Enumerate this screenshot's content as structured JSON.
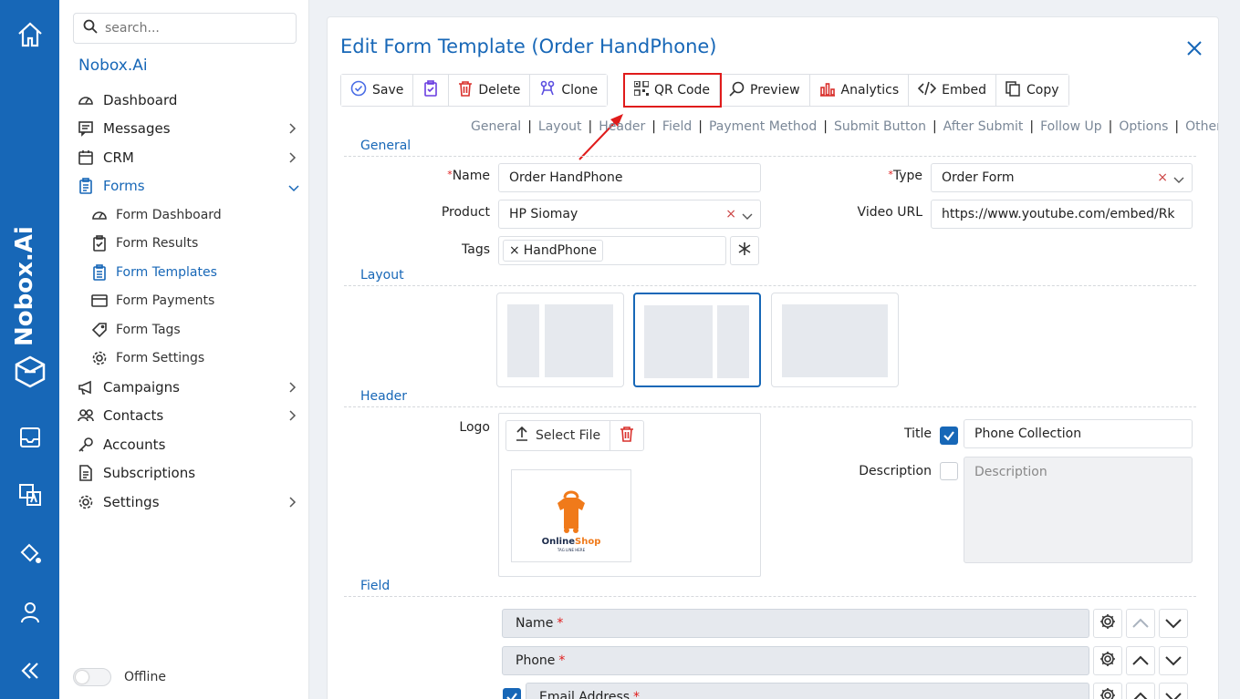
{
  "rail": {
    "brand": "Nobox.Ai",
    "icons": [
      "home-icon",
      "nobox-logo-icon",
      "inbox-icon",
      "translate-icon",
      "paint-bucket-icon",
      "user-icon",
      "collapse-icon"
    ]
  },
  "sidebar": {
    "search_placeholder": "search...",
    "org": "Nobox.Ai",
    "items": [
      {
        "label": "Dashboard",
        "icon": "gauge-icon"
      },
      {
        "label": "Messages",
        "icon": "message-icon"
      },
      {
        "label": "CRM",
        "icon": "crm-icon"
      },
      {
        "label": "Forms",
        "icon": "clipboard-icon"
      },
      {
        "label": "Form Dashboard",
        "icon": "gauge-icon"
      },
      {
        "label": "Form Results",
        "icon": "clipboard-check-icon"
      },
      {
        "label": "Form Templates",
        "icon": "clipboard-list-icon"
      },
      {
        "label": "Form Payments",
        "icon": "credit-card-icon"
      },
      {
        "label": "Form Tags",
        "icon": "tag-icon"
      },
      {
        "label": "Form Settings",
        "icon": "gear-icon"
      },
      {
        "label": "Campaigns",
        "icon": "megaphone-icon"
      },
      {
        "label": "Contacts",
        "icon": "contacts-icon"
      },
      {
        "label": "Accounts",
        "icon": "key-icon"
      },
      {
        "label": "Subscriptions",
        "icon": "document-icon"
      },
      {
        "label": "Settings",
        "icon": "gear-icon"
      }
    ],
    "offline_label": "Offline"
  },
  "page": {
    "title": "Edit Form Template (Order HandPhone)",
    "toolbar": {
      "save": "Save",
      "delete": "Delete",
      "clone": "Clone",
      "qr": "QR Code",
      "preview": "Preview",
      "analytics": "Analytics",
      "embed": "Embed",
      "copy": "Copy"
    },
    "tabs": [
      "General",
      "Layout",
      "Header",
      "Field",
      "Payment Method",
      "Submit Button",
      "After Submit",
      "Follow Up",
      "Options",
      "Other"
    ],
    "sections": {
      "general": "General",
      "layout": "Layout",
      "header": "Header",
      "field": "Field"
    },
    "general": {
      "name_label": "Name",
      "name_value": "Order HandPhone",
      "type_label": "Type",
      "type_value": "Order Form",
      "product_label": "Product",
      "product_value": "HP Siomay",
      "video_label": "Video URL",
      "video_value": "https://www.youtube.com/embed/Rk",
      "tags_label": "Tags",
      "tag_chip": "HandPhone"
    },
    "layout": {
      "selected": 1
    },
    "header": {
      "logo_label": "Logo",
      "select_file": "Select File",
      "logo_text": "OnlineShop",
      "logo_tagline": "TAG LINE HERE",
      "title_label": "Title",
      "title_checked": true,
      "title_value": "Phone Collection",
      "description_label": "Description",
      "description_checked": false,
      "description_placeholder": "Description"
    },
    "fields": [
      {
        "label": "Name",
        "required": true
      },
      {
        "label": "Phone",
        "required": true
      },
      {
        "label": "Email Address",
        "required": true
      }
    ]
  },
  "colors": {
    "primary": "#1767b7",
    "highlight": "#e01b1b",
    "required": "#e01b1b"
  }
}
